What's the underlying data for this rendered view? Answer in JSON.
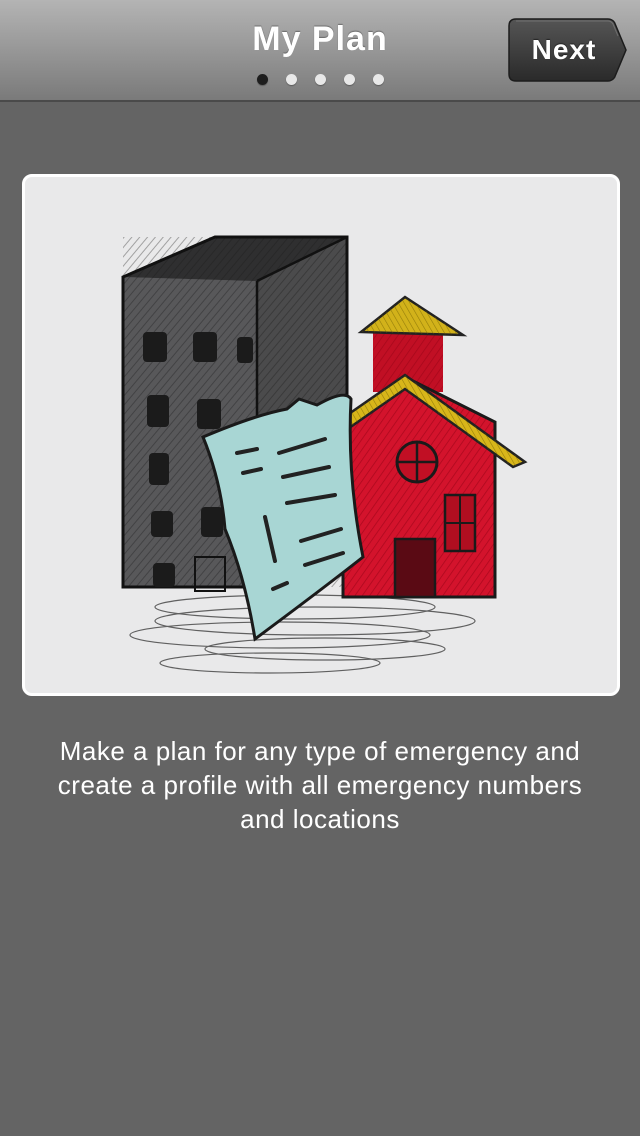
{
  "navbar": {
    "title": "My Plan",
    "next_label": "Next",
    "page_indicator": {
      "total": 5,
      "current": 1
    }
  },
  "content": {
    "illustration": "sketch of buildings and a document",
    "description": "Make a plan for any type of emergency and create a profile with all emergency numbers and locations"
  },
  "colors": {
    "background": "#646464",
    "navbar_top": "#b4b4b4",
    "navbar_bottom": "#7a7a7a",
    "next_button": "#3a3a3a",
    "card_background": "#e9e9ea",
    "text": "#ffffff"
  }
}
